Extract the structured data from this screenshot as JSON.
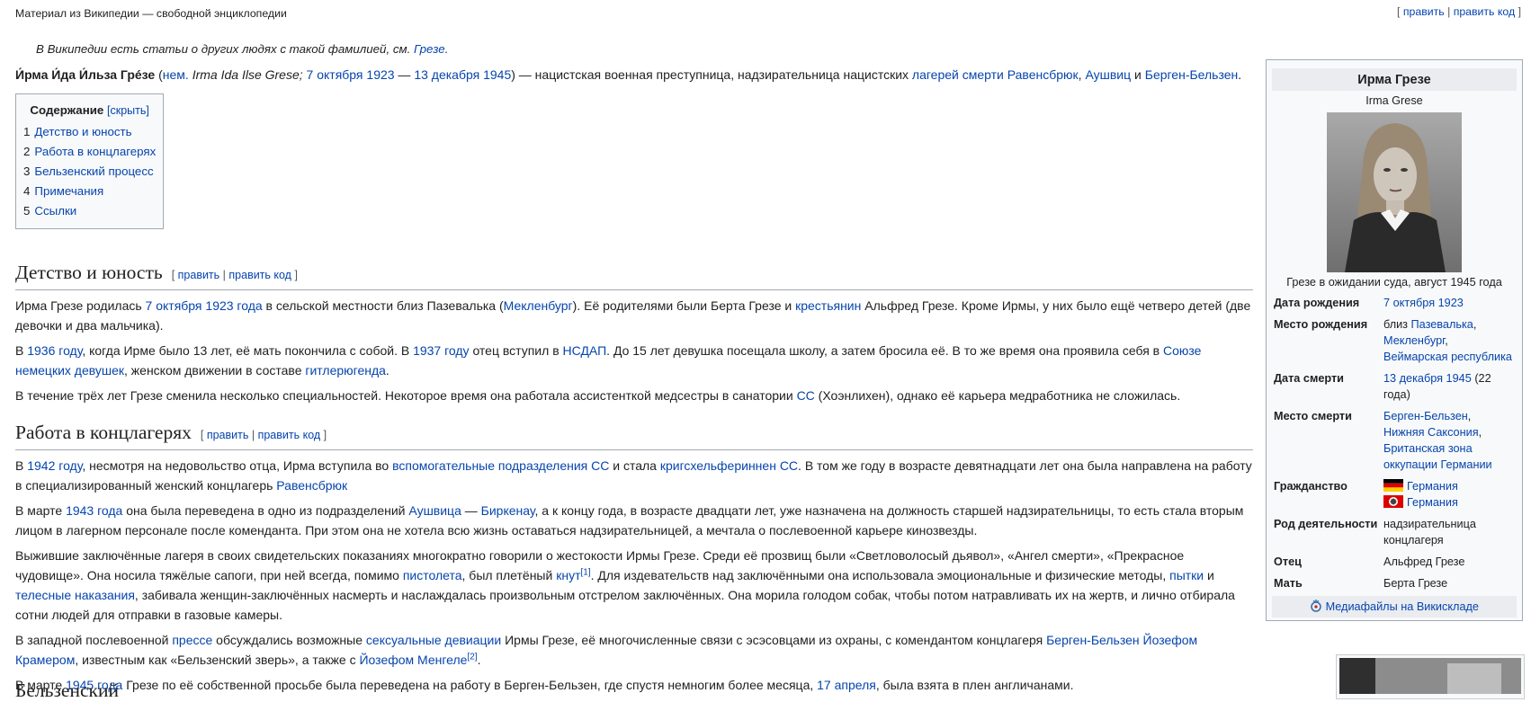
{
  "tagline": "Материал из Википедии — свободной энциклопедии",
  "top_edit": {
    "open": "[ ",
    "edit": "править",
    "sep": " | ",
    "edit_code": "править код",
    "close": " ]"
  },
  "hatnote": {
    "text": "В Википедии есть статьи о других людях с такой фамилией, см. ",
    "link": "Грезе",
    "end": "."
  },
  "lead": {
    "bold_name": "И́рма И́да И́льза Грéзе",
    "t1": " (",
    "l_lang": "нем.",
    "t2": " Irma Ida Ilse Grese; ",
    "l_birth": "7 октября 1923",
    "t3": " — ",
    "l_death": "13 декабря 1945",
    "t4": ") — нацистская военная преступница, надзирательница нацистских ",
    "l_camps": "лагерей смерти",
    "t5": " ",
    "l_rav": "Равенсбрюк",
    "t6": ", ",
    "l_ausch": "Аушвиц",
    "t7": " и ",
    "l_bergen": "Берген-Бельзен",
    "t8": "."
  },
  "toc": {
    "title": "Содержание",
    "toggle": "[скрыть]",
    "items": [
      {
        "num": "1",
        "label": "Детство и юность"
      },
      {
        "num": "2",
        "label": "Работа в концлагерях"
      },
      {
        "num": "3",
        "label": "Бельзенский процесс"
      },
      {
        "num": "4",
        "label": "Примечания"
      },
      {
        "num": "5",
        "label": "Ссылки"
      }
    ]
  },
  "edit_links": {
    "open": "[ ",
    "edit": "править",
    "sep": " | ",
    "edit_code": "править код",
    "close": " ]"
  },
  "sec1": {
    "heading": "Детство и юность",
    "p1": {
      "t1": "Ирма Грезе родилась ",
      "l1": "7 октября 1923 года",
      "t2": " в сельской местности близ Пазевалька (",
      "l2": "Мекленбург",
      "t3": "). Её родителями были Берта Грезе и ",
      "l3": "крестьянин",
      "t4": " Альфред Грезе. Кроме Ирмы, у них было ещё четверо детей (две девочки и два мальчика)."
    },
    "p2": {
      "t1": "В ",
      "l1": "1936 году",
      "t2": ", когда Ирме было 13 лет, её мать покончила с собой. В ",
      "l2": "1937 году",
      "t3": " отец вступил в ",
      "l3": "НСДАП",
      "t4": ". До 15 лет девушка посещала школу, а затем бросила её. В то же время она проявила себя в ",
      "l4": "Союзе немецких девушек",
      "t5": ", женском движении в составе ",
      "l5": "гитлерюгенда",
      "t6": "."
    },
    "p3": {
      "t1": "В течение трёх лет Грезе сменила несколько специальностей. Некоторое время она работала ассистенткой медсестры в санатории ",
      "l1": "СС",
      "t2": " (Хоэнлихен), однако её карьера медработника не сложилась."
    }
  },
  "sec2": {
    "heading": "Работа в концлагерях",
    "p1": {
      "t1": "В ",
      "l1": "1942 году",
      "t2": ", несмотря на недовольство отца, Ирма вступила во ",
      "l2": "вспомогательные подразделения СС",
      "t3": " и стала ",
      "l3": "кригсхельфериннен СС",
      "t4": ". В том же году в возрасте девятнадцати лет она была направлена на работу в специализированный женский концлагерь ",
      "l4": "Равенсбрюк"
    },
    "p2": {
      "t1": "В марте ",
      "l1": "1943 года",
      "t2": " она была переведена в одно из подразделений ",
      "l2": "Аушвица",
      "t3": " — ",
      "l3": "Биркенау",
      "t4": ", а к концу года, в возрасте двадцати лет, уже назначена на должность старшей надзирательницы, то есть стала вторым лицом в лагерном персонале после коменданта. При этом она не хотела всю жизнь оставаться надзирательницей, а мечтала о послевоенной карьере кинозвезды."
    },
    "p3": {
      "t1": "Выжившие заключённые лагеря в своих свидетельских показаниях многократно говорили о жестокости Ирмы Грезе. Среди её прозвищ были «Светловолосый дьявол», «Ангел смерти», «Прекрасное чудовище». Она носила тяжёлые сапоги, при ней всегда, помимо ",
      "l1": "пистолета",
      "t2": ", был плетёный ",
      "l2": "кнут",
      "sup1": "[1]",
      "t3": ". Для издевательств над заключёнными она использовала эмоциональные и физические методы, ",
      "l3": "пытки",
      "t4": " и ",
      "l4": "телесные наказания",
      "t5": ", забивала женщин-заключённых насмерть и наслаждалась произвольным отстрелом заключённых. Она морила голодом собак, чтобы потом натравливать их на жертв, и лично отбирала сотни людей для отправки в газовые камеры."
    },
    "p4": {
      "t1": "В западной послевоенной ",
      "l1": "прессе",
      "t2": " обсуждались возможные ",
      "l2": "сексуальные девиации",
      "t3": " Ирмы Грезе, её многочисленные связи с эсэсовцами из охраны, с комендантом концлагеря ",
      "l3": "Берген-Бельзен",
      "t4": " ",
      "l4": "Йозефом Крамером",
      "t5": ", известным как «Бельзенский зверь», а также с ",
      "l5": "Йозефом Менгеле",
      "sup1": "[2]",
      "t6": "."
    },
    "p5": {
      "t1": "В марте ",
      "l1": "1945 года",
      "t2": " Грезе по её собственной просьбе была переведена на работу в Берген-Бельзен, где спустя немногим более месяца, ",
      "l2": "17 апреля",
      "t3": ", была взята в плен англичанами."
    }
  },
  "sec3_heading_partial": "Бельзенский",
  "infobox": {
    "title": "Ирма Грезе",
    "subtitle": "Irma Grese",
    "caption": "Грезе в ожидании суда, август 1945 года",
    "rows": {
      "birth_date": {
        "label": "Дата рождения",
        "link": "7 октября 1923"
      },
      "birth_place": {
        "label": "Место рождения",
        "text": "близ ",
        "l1": "Пазевалька",
        "sep1": ", ",
        "l2": "Мекленбург",
        "sep2": ", ",
        "l3": "Веймарская республика"
      },
      "death_date": {
        "label": "Дата смерти",
        "link": "13 декабря 1945",
        "text": " (22 года)"
      },
      "death_place": {
        "label": "Место смерти",
        "l1": "Берген-Бельзен",
        "sep1": ", ",
        "l2": "Нижняя Саксония",
        "sep2": ", ",
        "l3": "Британская зона оккупации Германии"
      },
      "citizenship": {
        "label": "Гражданство",
        "c1": "Германия",
        "c2": "Германия"
      },
      "occupation": {
        "label": "Род деятельности",
        "text": "надзирательница концлагеря"
      },
      "father": {
        "label": "Отец",
        "text": "Альфред Грезе"
      },
      "mother": {
        "label": "Мать",
        "text": "Берта Грезе"
      }
    },
    "commons": "Медиафайлы на Викискладе"
  },
  "colors": {
    "link": "#0645ad",
    "border": "#a2a9b1",
    "infobox_bg": "#f8f9fa",
    "header_bg": "#eaecf0"
  }
}
